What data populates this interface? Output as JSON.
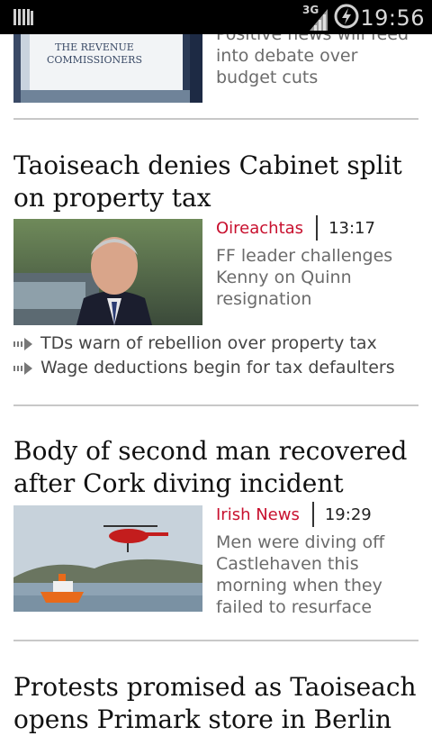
{
  "status_bar": {
    "network": "3G",
    "time": "19:56"
  },
  "articles": [
    {
      "headline": "",
      "summary": "Positive news will feed into debate over budget cuts",
      "image_sign_text": "The Revenue Commissioners"
    },
    {
      "headline": "Taoiseach denies Cabinet split on property tax",
      "source": "Oireachtas",
      "time": "13:17",
      "summary": "FF leader challenges Kenny on Quinn resignation",
      "related": [
        "TDs warn of rebellion over property tax",
        "Wage deductions begin for tax defaulters"
      ]
    },
    {
      "headline": "Body of second man recovered after Cork diving incident",
      "source": "Irish News",
      "time": "19:29",
      "summary": "Men were diving off Castlehaven this morning when they failed to resurface"
    },
    {
      "headline": "Protests promised as Taoiseach opens Primark store in Berlin"
    }
  ],
  "colors": {
    "source_red": "#c8102e",
    "summary_gray": "#6b6b6b",
    "divider": "#c8c8c8"
  }
}
